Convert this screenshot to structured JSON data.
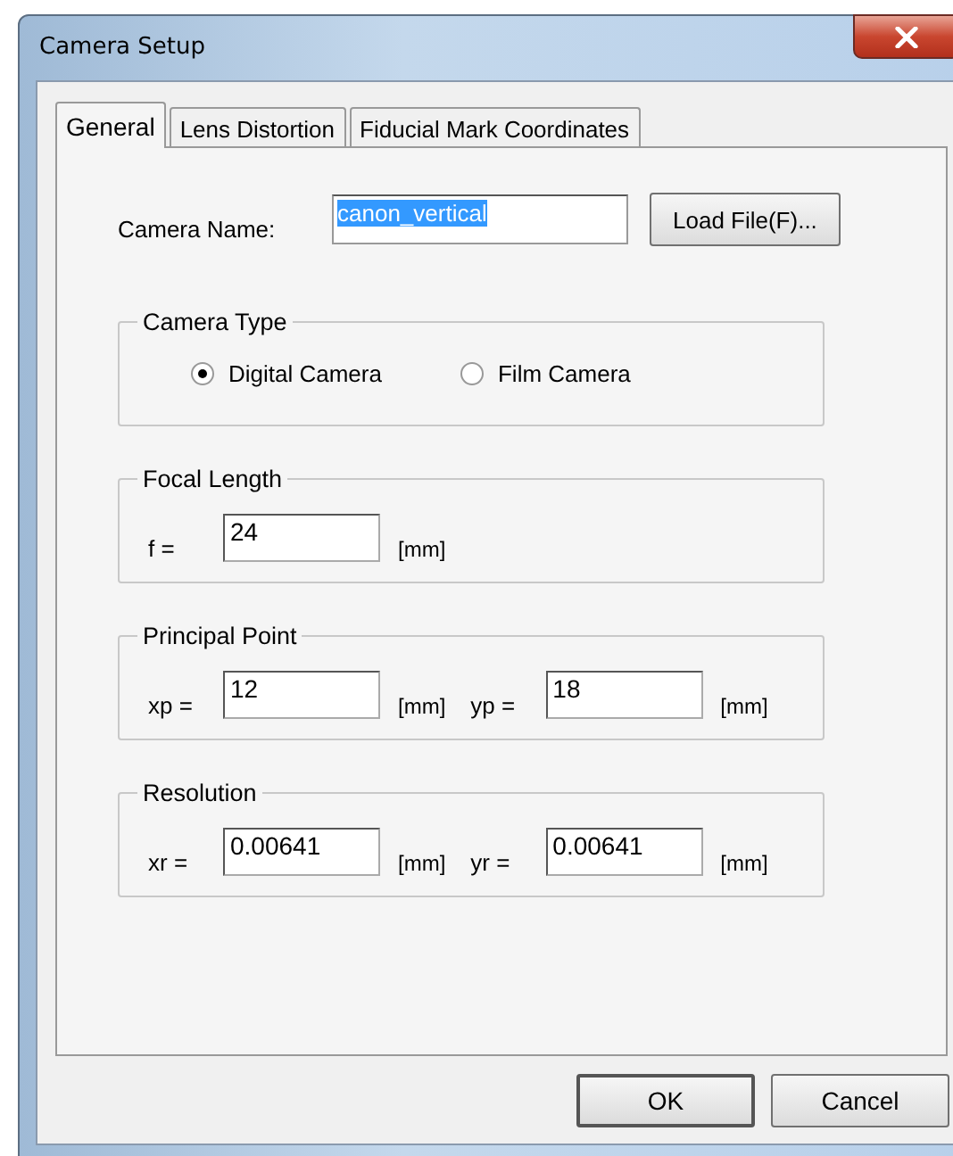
{
  "window": {
    "title": "Camera Setup"
  },
  "tabs": [
    {
      "label": "General",
      "selected": true
    },
    {
      "label": "Lens Distortion",
      "selected": false
    },
    {
      "label": "Fiducial Mark Coordinates",
      "selected": false
    }
  ],
  "camera_name": {
    "label": "Camera Name:",
    "value": "canon_vertical",
    "selected": true
  },
  "load_button": "Load File(F)...",
  "groups": [
    {
      "kind": "radio",
      "title": "Camera Type",
      "options": [
        {
          "label": "Digital Camera",
          "selected": true
        },
        {
          "label": "Film Camera",
          "selected": false
        }
      ]
    },
    {
      "kind": "fields",
      "title": "Focal Length",
      "fields": [
        {
          "label": "f =",
          "value": "24",
          "unit": "[mm]"
        }
      ]
    },
    {
      "kind": "fields",
      "title": "Principal Point",
      "fields": [
        {
          "label": "xp =",
          "value": "12",
          "unit": "[mm]"
        },
        {
          "label": "yp =",
          "value": "18",
          "unit": "[mm]"
        }
      ]
    },
    {
      "kind": "fields",
      "title": "Resolution",
      "fields": [
        {
          "label": "xr =",
          "value": "0.00641",
          "unit": "[mm]"
        },
        {
          "label": "yr =",
          "value": "0.00641",
          "unit": "[mm]"
        }
      ]
    }
  ],
  "buttons": [
    "OK",
    "Cancel"
  ]
}
